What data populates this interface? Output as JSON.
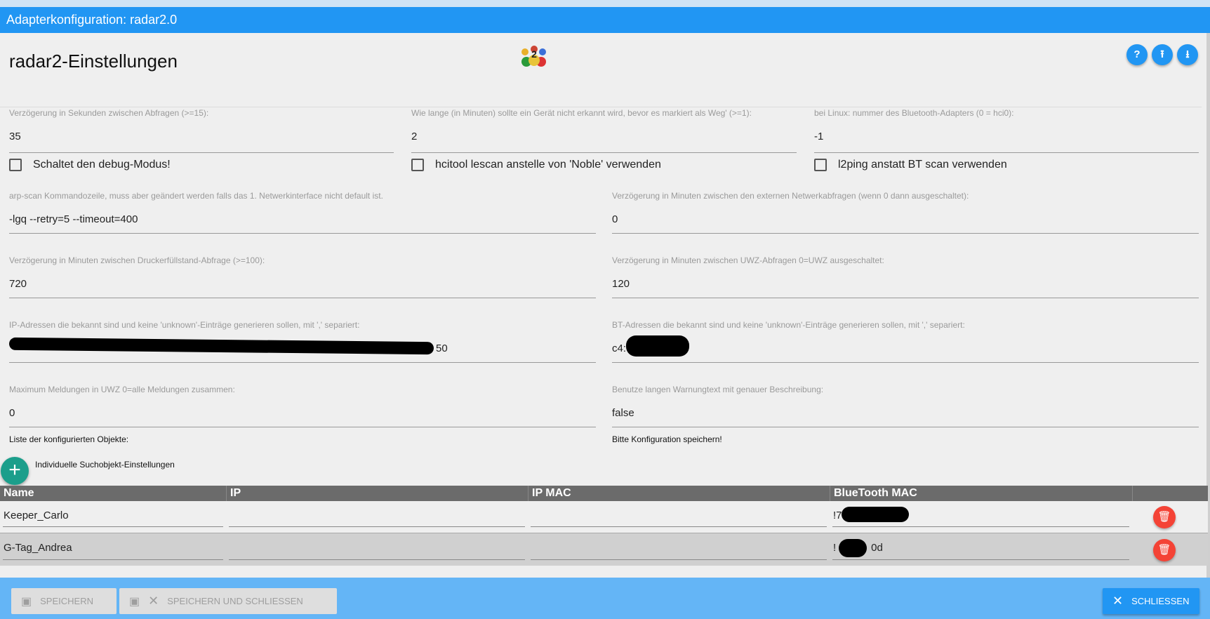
{
  "window": {
    "title": "Adapterkonfiguration: radar2.0"
  },
  "header": {
    "title": "radar2-Einstellungen",
    "logo": "radar2-people-logo",
    "actions": [
      {
        "icon": "help-icon",
        "glyph": "?"
      },
      {
        "icon": "upload-icon",
        "glyph": "⭱"
      },
      {
        "icon": "download-icon",
        "glyph": "⭳"
      }
    ]
  },
  "fields_top": [
    {
      "label": "Verzögerung in Sekunden zwischen Abfragen (>=15):",
      "value": "35"
    },
    {
      "label": "Wie lange (in Minuten) sollte ein Gerät nicht erkannt wird, bevor es markiert als Weg' (>=1):",
      "value": "2"
    },
    {
      "label": "bei Linux: nummer des Bluetooth-Adapters (0 = hci0):",
      "value": "-1"
    }
  ],
  "checkboxes": [
    {
      "label": "Schaltet den debug-Modus!",
      "checked": false
    },
    {
      "label": "hcitool lescan anstelle von 'Noble' verwenden",
      "checked": false
    },
    {
      "label": "l2ping anstatt BT scan verwenden",
      "checked": false
    }
  ],
  "fields": [
    {
      "label": "arp-scan Kommandozeile, muss aber geändert werden falls das 1. Netwerkinterface nicht default ist.",
      "value": "-lgq --retry=5 --timeout=400"
    },
    {
      "label": "Verzögerung in Minuten zwischen den externen Netwerkabfragen (wenn 0 dann ausgeschaltet):",
      "value": "0"
    },
    {
      "label": "Verzögerung in Minuten zwischen Druckerfüllstand-Abfrage (>=100):",
      "value": "720"
    },
    {
      "label": "Verzögerung in Minuten zwischen UWZ-Abfragen 0=UWZ ausgeschaltet:",
      "value": "120"
    },
    {
      "label": "IP-Adressen die bekannt sind und keine 'unknown'-Einträge generieren sollen, mit ',' separiert:",
      "value": "50"
    },
    {
      "label": "BT-Adressen die bekannt sind und keine 'unknown'-Einträge generieren sollen, mit ',' separiert:",
      "value": "c4:        e6"
    },
    {
      "label": "Maximum Meldungen in UWZ 0=alle Meldungen zusammen:",
      "value": "0"
    },
    {
      "label": "Benutze langen Warnungtext mit genauer Beschreibung:",
      "value": "false"
    }
  ],
  "list": {
    "title": "Liste der konfigurierten Objekte:",
    "save_hint": "Bitte Konfiguration speichern!",
    "add_label": "Individuelle Suchobjekt-Einstellungen"
  },
  "table": {
    "columns": [
      "Name",
      "IP",
      "IP MAC",
      "BlueTooth MAC"
    ],
    "rows": [
      {
        "name": "Keeper_Carlo",
        "ip": "",
        "ipmac": "",
        "btmac": "!7           e"
      },
      {
        "name": "G-Tag_Andrea",
        "ip": "",
        "ipmac": "",
        "btmac": "!            0d"
      }
    ]
  },
  "footer": {
    "save": "SPEICHERN",
    "save_close": "SPEICHERN UND SCHLIESSEN",
    "close": "SCHLIESSEN"
  },
  "colors": {
    "primary": "#2196f3",
    "footer": "#64b5f6",
    "add": "#1b9e8b",
    "delete": "#f44336"
  }
}
